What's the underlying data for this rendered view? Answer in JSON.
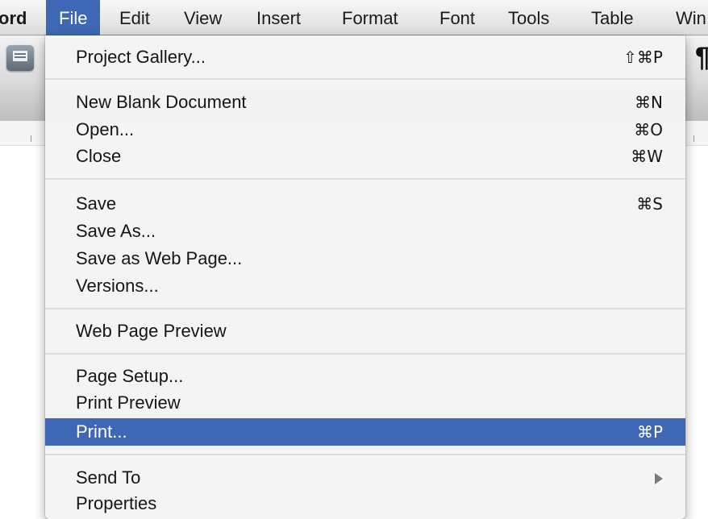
{
  "menubar": {
    "app_partial": "ord",
    "items": [
      "File",
      "Edit",
      "View",
      "Insert",
      "Format",
      "Font",
      "Tools",
      "Table",
      "Win"
    ],
    "active": "File"
  },
  "toolbar": {
    "print_icon": "print-icon",
    "pilcrow_icon": "¶"
  },
  "file_menu": {
    "project_gallery": {
      "label": "Project Gallery...",
      "shortcut": "⇧⌘P"
    },
    "new_blank_document": {
      "label": "New Blank Document",
      "shortcut": "⌘N"
    },
    "open": {
      "label": "Open...",
      "shortcut": "⌘O"
    },
    "close": {
      "label": "Close",
      "shortcut": "⌘W"
    },
    "save": {
      "label": "Save",
      "shortcut": "⌘S"
    },
    "save_as": {
      "label": "Save As..."
    },
    "save_as_web_page": {
      "label": "Save as Web Page..."
    },
    "versions": {
      "label": "Versions..."
    },
    "web_page_preview": {
      "label": "Web Page Preview"
    },
    "page_setup": {
      "label": "Page Setup..."
    },
    "print_preview": {
      "label": "Print Preview"
    },
    "print": {
      "label": "Print...",
      "shortcut": "⌘P",
      "highlighted": true
    },
    "send_to": {
      "label": "Send To",
      "submenu": true
    },
    "properties": {
      "label": "Properties"
    }
  },
  "colors": {
    "highlight": "#3e68b3",
    "menu_bg": "#f4f4f4"
  }
}
